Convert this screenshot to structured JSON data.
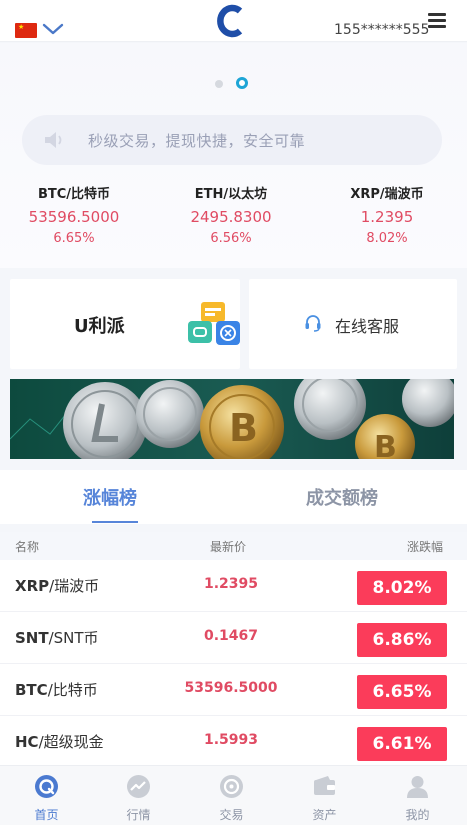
{
  "header": {
    "user": "155******555",
    "flag_icon": "china-flag-icon",
    "logo_icon": "app-logo-c"
  },
  "banner": {
    "notice": "秒级交易，提现快捷，安全可靠"
  },
  "tickers": [
    {
      "name": "BTC/比特币",
      "price": "53596.5000",
      "change": "6.65%"
    },
    {
      "name": "ETH/以太坊",
      "price": "2495.8300",
      "change": "6.56%"
    },
    {
      "name": "XRP/瑞波币",
      "price": "1.2395",
      "change": "8.02%"
    }
  ],
  "cards": {
    "ulipai": "U利派",
    "service": "在线客服"
  },
  "tabs": {
    "gainers": "涨幅榜",
    "volume": "成交额榜"
  },
  "list": {
    "headers": {
      "name": "名称",
      "price": "最新价",
      "change": "涨跌幅"
    },
    "rows": [
      {
        "base": "XRP",
        "name": "/瑞波币",
        "price": "1.2395",
        "change": "8.02%"
      },
      {
        "base": "SNT",
        "name": "/SNT币",
        "price": "0.1467",
        "change": "6.86%"
      },
      {
        "base": "BTC",
        "name": "/比特币",
        "price": "53596.5000",
        "change": "6.65%"
      },
      {
        "base": "HC",
        "name": "/超级现金",
        "price": "1.5993",
        "change": "6.61%"
      }
    ]
  },
  "nav": {
    "home": "首页",
    "market": "行情",
    "trade": "交易",
    "assets": "资产",
    "mine": "我的"
  },
  "colors": {
    "accent": "#5785d9",
    "up": "#e04b63",
    "badge": "#fb3c5a",
    "active_dot": "#1ea5d6"
  }
}
